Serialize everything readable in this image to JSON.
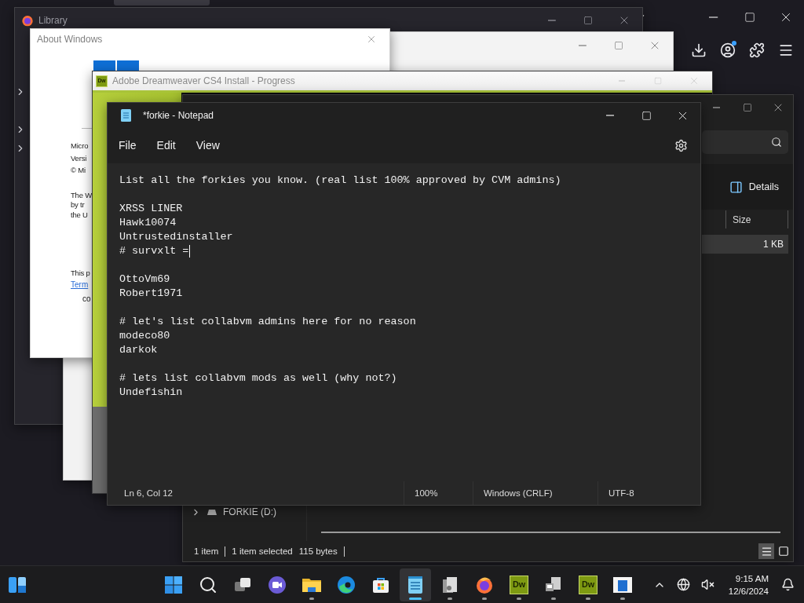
{
  "library_window": {
    "title": "Library"
  },
  "about_window": {
    "title": "About Windows",
    "info_lines": [
      "Micro",
      "Versi",
      "© Mi"
    ],
    "notice_lines": [
      "The W",
      "by tr",
      "the U"
    ],
    "license": "This p",
    "link": "Term",
    "footer": "co"
  },
  "installer_window": {
    "icon_label": "Dw",
    "title": "Adobe Dreamweaver CS4 Install - Progress"
  },
  "explorer_window": {
    "details_button": "Details",
    "columns": [
      "Size"
    ],
    "rows": [
      {
        "size": "1 KB",
        "selected": true
      }
    ],
    "nav_items": [
      {
        "label": "FORKIE (D:)",
        "expanded": false
      }
    ],
    "status": [
      "1 item",
      "1 item selected",
      "115 bytes"
    ],
    "views": [
      {
        "kind": "details",
        "selected": true
      },
      {
        "kind": "tiles",
        "selected": false
      }
    ]
  },
  "notepad": {
    "title": "*forkie - Notepad",
    "menu": [
      "File",
      "Edit",
      "View"
    ],
    "paragraphs": [
      [
        {
          "text": "List all the forkies you know. (real list 100% approved by CVM admins)",
          "caret": false
        }
      ],
      [
        {
          "text": "XRSS LINER",
          "caret": false
        },
        {
          "text": "Hawk10074",
          "caret": false
        },
        {
          "text": "Untrustedinstaller",
          "caret": false
        },
        {
          "text": "# survxlt =",
          "caret": true
        }
      ],
      [
        {
          "text": "OttoVm69",
          "caret": false
        },
        {
          "text": "Robert1971",
          "caret": false
        }
      ],
      [
        {
          "text": "# let's list collabvm admins here for no reason",
          "caret": false
        },
        {
          "text": "modeco80",
          "caret": false
        },
        {
          "text": "darkok",
          "caret": false
        }
      ],
      [
        {
          "text": "# lets list collabvm mods as well (why not?)",
          "caret": false
        },
        {
          "text": "Undefishin",
          "caret": false
        }
      ]
    ],
    "status": {
      "position": "Ln 6, Col 12",
      "zoom": "100%",
      "line_ending": "Windows (CRLF)",
      "encoding": "UTF-8"
    }
  },
  "taskbar": {
    "apps": [
      {
        "kind": "start",
        "selected": false,
        "running": false
      },
      {
        "kind": "search",
        "selected": false,
        "running": false
      },
      {
        "kind": "taskview",
        "selected": false,
        "running": false
      },
      {
        "kind": "meet",
        "selected": false,
        "running": false
      },
      {
        "kind": "explorer",
        "selected": false,
        "running": true
      },
      {
        "kind": "edge",
        "selected": false,
        "running": false
      },
      {
        "kind": "store",
        "selected": false,
        "running": false
      },
      {
        "kind": "notepad",
        "selected": true,
        "running": true
      },
      {
        "kind": "files",
        "selected": false,
        "running": true
      },
      {
        "kind": "firefox",
        "selected": false,
        "running": true
      },
      {
        "kind": "dreamweaver",
        "label": "Dw",
        "selected": false,
        "running": true
      },
      {
        "kind": "installer",
        "selected": false,
        "running": true
      },
      {
        "kind": "dreamweaver",
        "label": "Dw",
        "selected": false,
        "running": true
      },
      {
        "kind": "window",
        "selected": false,
        "running": true
      }
    ],
    "time": "9:15 AM",
    "date": "12/6/2024"
  }
}
